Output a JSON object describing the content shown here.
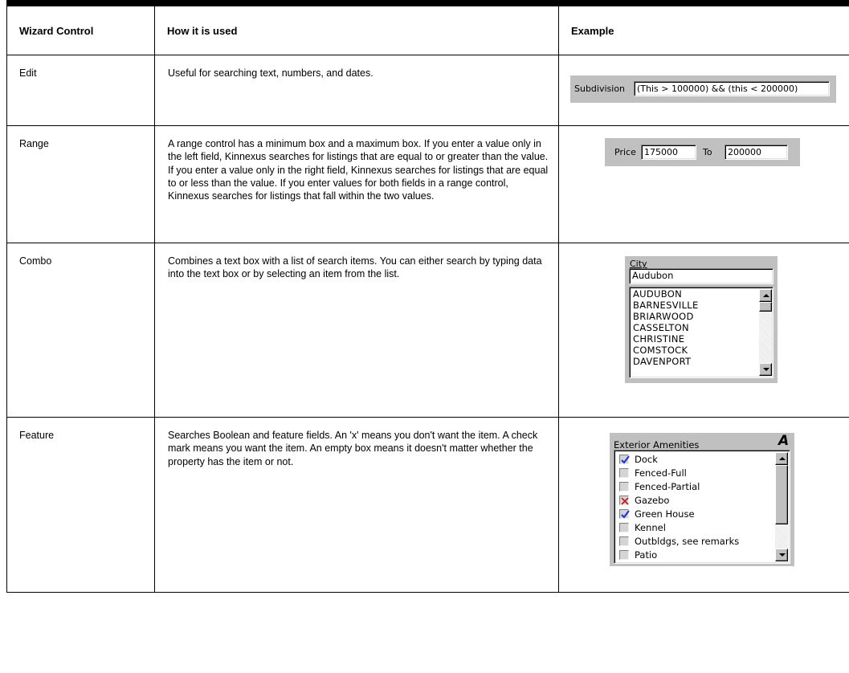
{
  "table": {
    "headers": [
      "Wizard Control",
      "How it is used",
      "Example"
    ],
    "rows": [
      {
        "control": "Edit",
        "description": "Useful for searching text, numbers, and dates."
      },
      {
        "control": "Range",
        "description": "A range control has a minimum box and a maximum box. If you enter a value only in the left field, Kinnexus searches for listings that are equal to or greater than the value. If you enter a value only in the right field, Kinnexus searches for listings that are equal to or less than the value. If you enter values for both fields in a range control, Kinnexus searches for listings that fall within the two values."
      },
      {
        "control": "Combo",
        "description": "Combines a text box with a list of search items. You can either search by typing data into the text box or by selecting an item from the list."
      },
      {
        "control": "Feature",
        "description": "Searches Boolean and feature fields. An 'x' means you don't want the item. A check mark means you want the item. An empty box means it doesn't matter whether the property has the item or not."
      }
    ]
  },
  "examples": {
    "edit": {
      "label": "Subdivision",
      "value": "(This > 100000) && (this < 200000)"
    },
    "range": {
      "label": "Price",
      "min_value": "175000",
      "to_label": "To",
      "max_value": "200000"
    },
    "combo": {
      "label": "City",
      "value": "Audubon",
      "items": [
        "AUDUBON",
        "BARNESVILLE",
        "BRIARWOOD",
        "CASSELTON",
        "CHRISTINE",
        "COMSTOCK",
        "DAVENPORT"
      ]
    },
    "feature": {
      "label": "Exterior Amenities",
      "corner_glyph": "A",
      "items": [
        {
          "label": "Dock",
          "state": "checked"
        },
        {
          "label": "Fenced-Full",
          "state": "empty"
        },
        {
          "label": "Fenced-Partial",
          "state": "empty"
        },
        {
          "label": "Gazebo",
          "state": "excluded"
        },
        {
          "label": "Green House",
          "state": "checked"
        },
        {
          "label": "Kennel",
          "state": "empty"
        },
        {
          "label": "Outbldgs, see remarks",
          "state": "empty"
        },
        {
          "label": "Patio",
          "state": "empty"
        }
      ]
    }
  },
  "colors": {
    "check": "#1a2fd0",
    "excluded": "#c21a1a",
    "dialog_gray": "#c0c0c0"
  }
}
